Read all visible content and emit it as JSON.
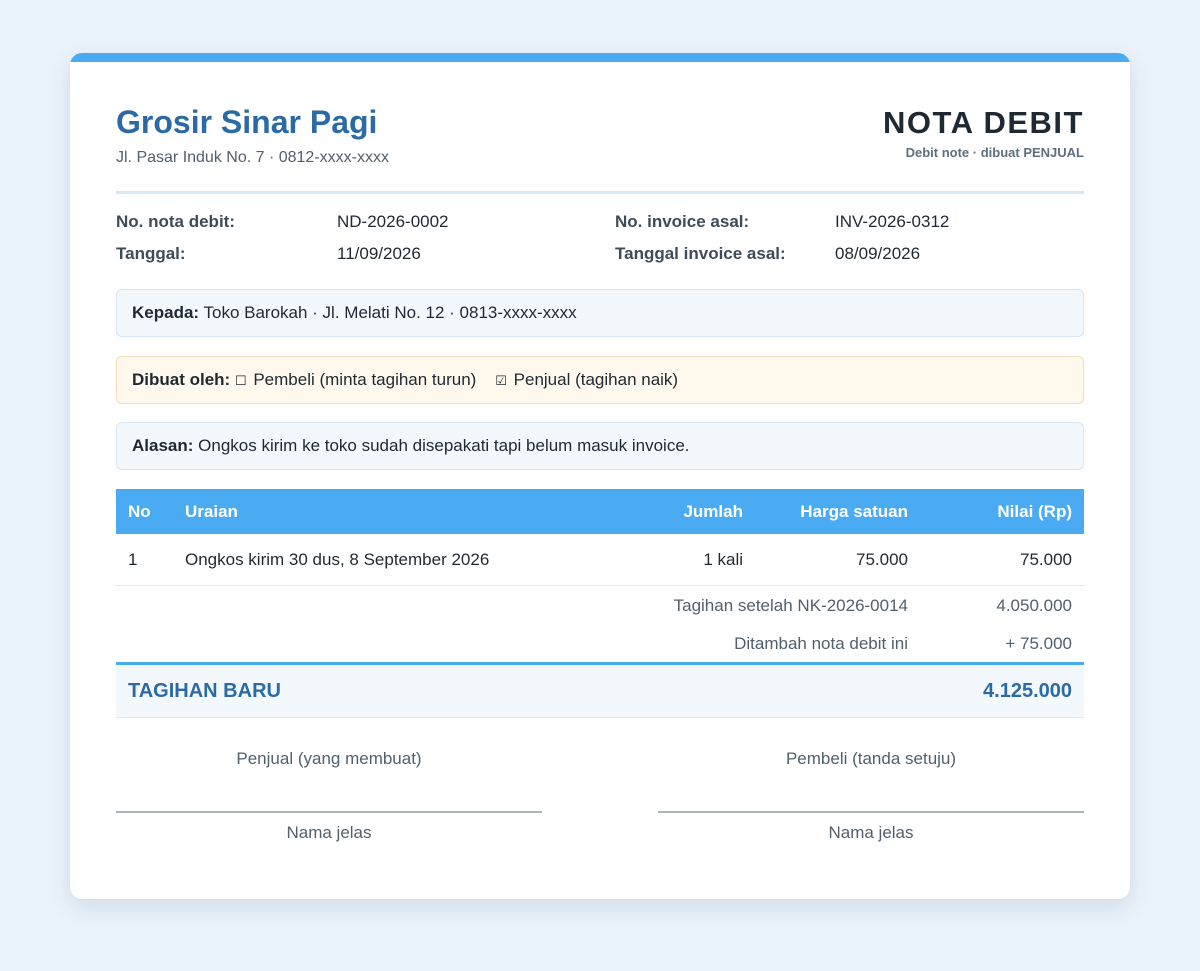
{
  "seller": {
    "name": "Grosir Sinar Pagi",
    "address": "Jl. Pasar Induk No. 7 · 0812-xxxx-xxxx"
  },
  "document": {
    "title": "NOTA DEBIT",
    "subtitle": "Debit note · dibuat PENJUAL"
  },
  "meta": {
    "note_no_label": "No. nota debit:",
    "note_no": "ND-2026-0002",
    "date_label": "Tanggal:",
    "date": "11/09/2026",
    "invoice_no_label": "No. invoice asal:",
    "invoice_no": "INV-2026-0312",
    "invoice_date_label": "Tanggal invoice asal:",
    "invoice_date": "08/09/2026"
  },
  "recipient": {
    "label": "Kepada:",
    "value": "Toko Barokah · Jl. Melati No. 12 · 0813-xxxx-xxxx"
  },
  "made_by": {
    "label": "Dibuat oleh:",
    "buyer_check": "☐",
    "buyer_option": "Pembeli (minta tagihan turun)",
    "seller_check": "☑",
    "seller_option": "Penjual (tagihan naik)"
  },
  "reason": {
    "label": "Alasan:",
    "value": "Ongkos kirim ke toko sudah disepakati tapi belum masuk invoice."
  },
  "table": {
    "headers": {
      "no": "No",
      "description": "Uraian",
      "quantity": "Jumlah",
      "unit_price": "Harga satuan",
      "amount": "Nilai (Rp)"
    },
    "rows": [
      {
        "no": "1",
        "description": "Ongkos kirim 30 dus, 8 September 2026",
        "quantity": "1 kali",
        "unit_price": "75.000",
        "amount": "75.000"
      }
    ]
  },
  "summary": {
    "previous_label": "Tagihan setelah NK-2026-0014",
    "previous_value": "4.050.000",
    "added_label": "Ditambah nota debit ini",
    "added_value": "+ 75.000",
    "new_total_label": "TAGIHAN BARU",
    "new_total_value": "4.125.000"
  },
  "signatures": {
    "seller_role": "Penjual (yang membuat)",
    "seller_name_label": "Nama jelas",
    "buyer_role": "Pembeli (tanda setuju)",
    "buyer_name_label": "Nama jelas"
  },
  "colors": {
    "accent": "#4aabf2",
    "brand": "#2c6aa6"
  }
}
